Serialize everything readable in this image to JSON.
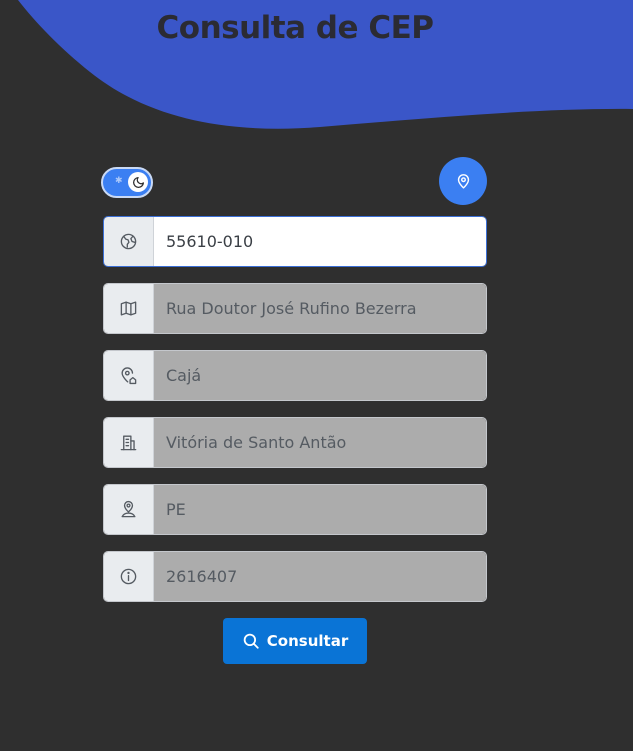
{
  "header": {
    "title": "Consulta de CEP"
  },
  "theme_toggle": {
    "sun_icon": "sun-icon",
    "moon_icon": "moon-icon",
    "dark_mode": true
  },
  "geo_button": {
    "icon": "map-pin-icon"
  },
  "fields": {
    "cep": {
      "value": "55610-010",
      "icon": "globe-icon",
      "active": true
    },
    "street": {
      "value": "Rua Doutor José Rufino Bezerra",
      "icon": "map-icon"
    },
    "district": {
      "value": "Cajá",
      "icon": "map-pin-home-icon"
    },
    "city": {
      "value": "Vitória de Santo Antão",
      "icon": "building-icon"
    },
    "state": {
      "value": "PE",
      "icon": "user-pin-icon"
    },
    "ibge": {
      "value": "2616407",
      "icon": "info-circle-icon"
    }
  },
  "consult_button": {
    "label": "Consultar",
    "icon": "search-icon"
  },
  "colors": {
    "background": "#2f2f2f",
    "wave": "#3a56c8",
    "accent": "#3b7ff2",
    "button": "#0a74d6",
    "readonly_field": "#acacac"
  }
}
